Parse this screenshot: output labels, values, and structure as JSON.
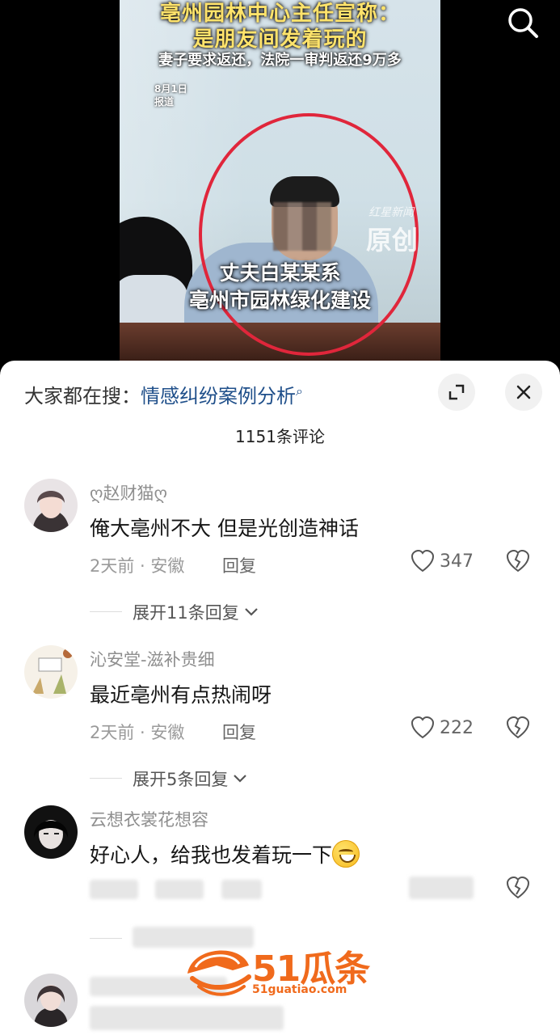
{
  "video": {
    "headline_line1": "亳州园林中心主任宣称：",
    "headline_line2": "是朋友间发着玩的",
    "subheadline": "妻子要求返还，法院一审判返还9万多",
    "date_line1": "8月1日",
    "date_line2": "报道",
    "watermark_small": "红星新闻",
    "watermark_big": "原创",
    "caption_line1": "丈夫白某某系",
    "caption_line2": "亳州市园林绿化建设"
  },
  "comments_panel": {
    "suggest_label": "大家都在搜：",
    "suggest_keyword": "情感纠纷案例分析",
    "comment_count": "1151条评论"
  },
  "comments": [
    {
      "user": "ღ赵财猫ღ",
      "text": "俺大亳州不大 但是光创造神话",
      "meta": "2天前 · 安徽",
      "reply": "回复",
      "likes": "347",
      "expand": "展开11条回复"
    },
    {
      "user": "沁安堂-滋补贵细",
      "text": "最近亳州有点热闹呀",
      "meta": "2天前 · 安徽",
      "reply": "回复",
      "likes": "222",
      "expand": "展开5条回复"
    },
    {
      "user": "云想衣裳花想容",
      "text": "好心人，给我也发着玩一下"
    }
  ],
  "overlay_logo": {
    "brand": "51瓜条",
    "domain": "51guatiao.com"
  },
  "colors": {
    "accent_link": "#1f4f8a",
    "circle": "#e0263b",
    "headline": "#ffe36b",
    "logo": "#f06a1c"
  }
}
